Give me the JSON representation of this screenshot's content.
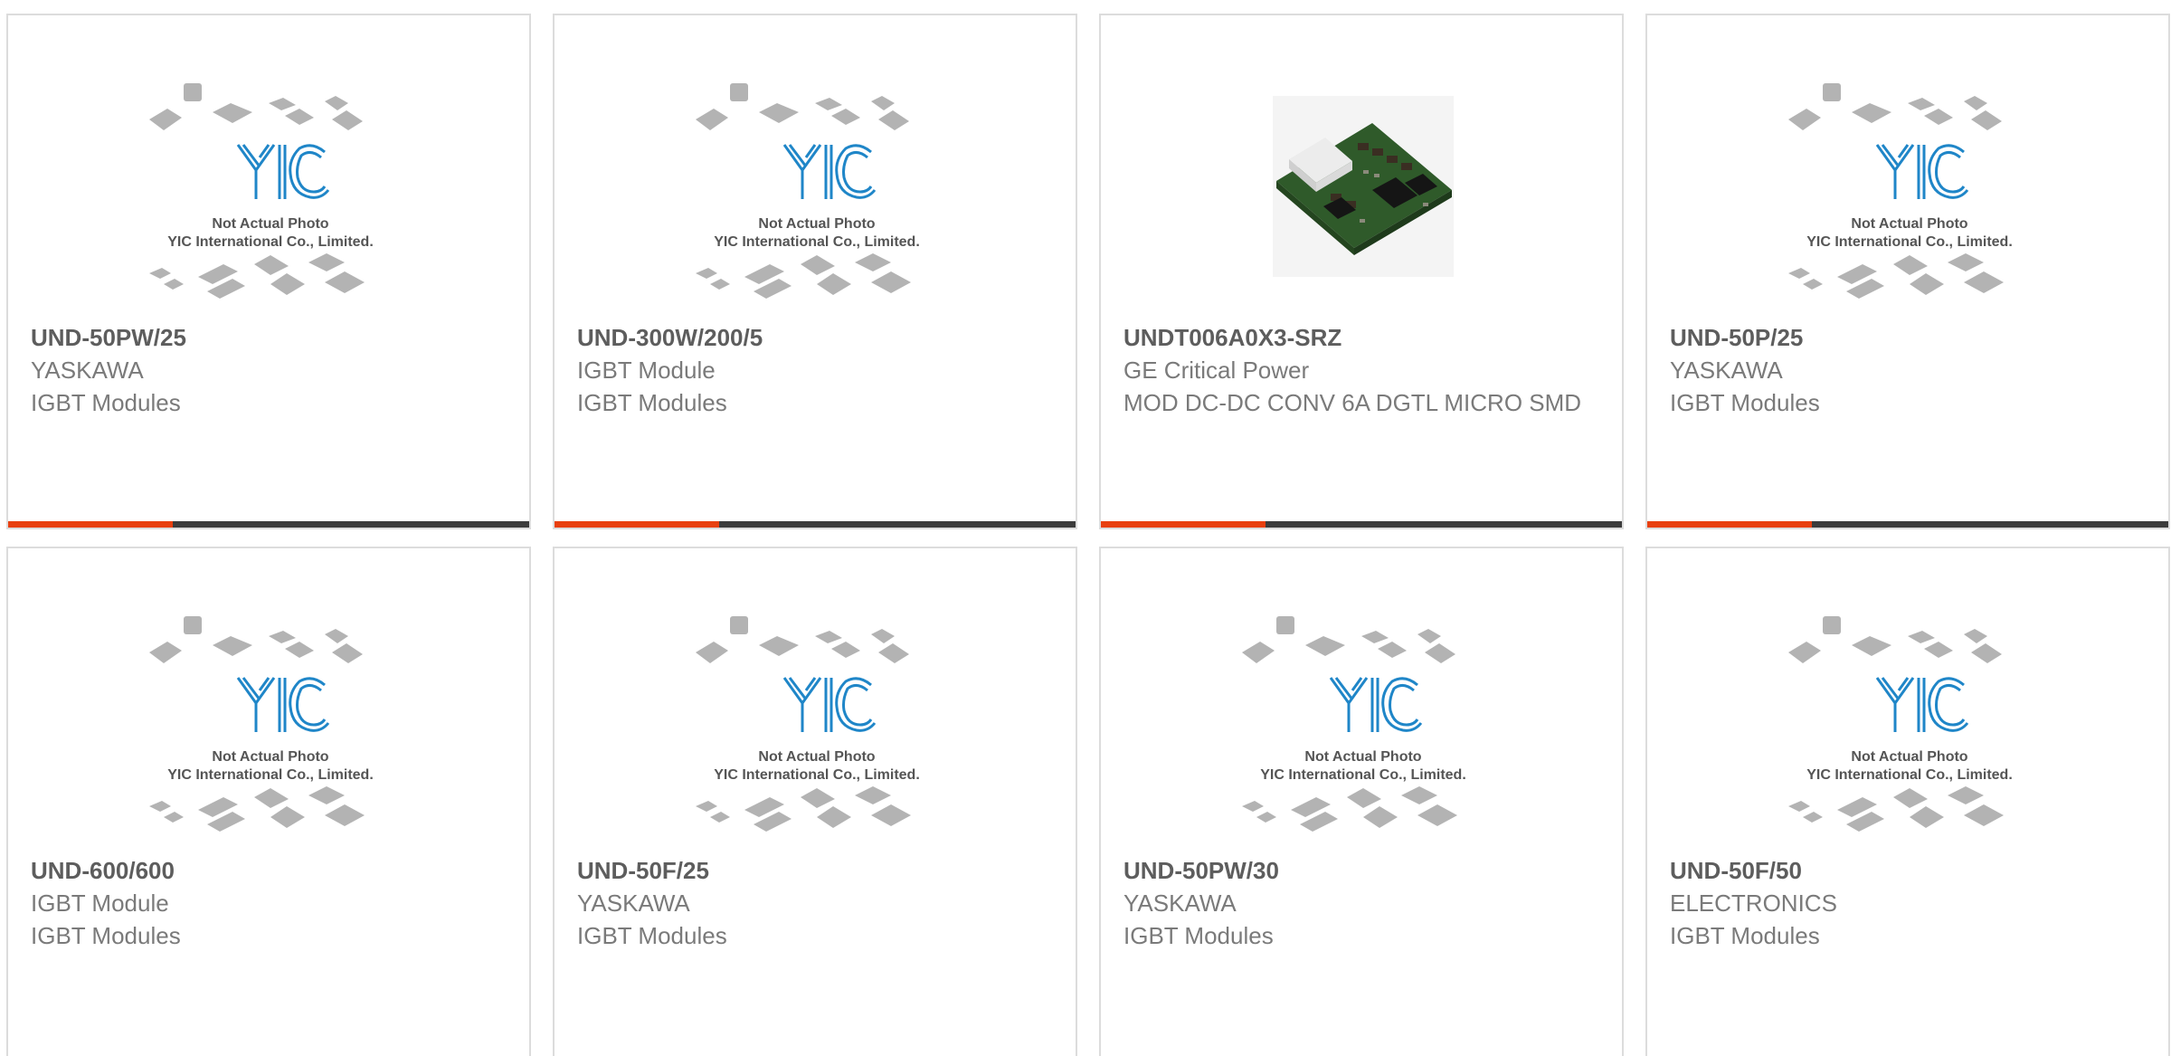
{
  "placeholder": {
    "line1": "Not Actual Photo",
    "line2": "YIC International Co., Limited."
  },
  "colors": {
    "accent": "#e8400f",
    "bar": "#3c3c3c",
    "logo": "#1f86c8"
  },
  "products": [
    {
      "part_number": "UND-50PW/25",
      "manufacturer": "YASKAWA",
      "description": "IGBT Modules",
      "image": "yic-placeholder"
    },
    {
      "part_number": "UND-300W/200/5",
      "manufacturer": "IGBT Module",
      "description": "IGBT Modules",
      "image": "yic-placeholder"
    },
    {
      "part_number": "UNDT006A0X3-SRZ",
      "manufacturer": "GE Critical Power",
      "description": "MOD DC-DC CONV 6A DGTL MICRO SMD",
      "image": "product-photo"
    },
    {
      "part_number": "UND-50P/25",
      "manufacturer": "YASKAWA",
      "description": "IGBT Modules",
      "image": "yic-placeholder"
    },
    {
      "part_number": "UND-600/600",
      "manufacturer": "IGBT Module",
      "description": "IGBT Modules",
      "image": "yic-placeholder"
    },
    {
      "part_number": "UND-50F/25",
      "manufacturer": "YASKAWA",
      "description": "IGBT Modules",
      "image": "yic-placeholder"
    },
    {
      "part_number": "UND-50PW/30",
      "manufacturer": "YASKAWA",
      "description": "IGBT Modules",
      "image": "yic-placeholder"
    },
    {
      "part_number": "UND-50F/50",
      "manufacturer": "ELECTRONICS",
      "description": "IGBT Modules",
      "image": "yic-placeholder"
    }
  ]
}
